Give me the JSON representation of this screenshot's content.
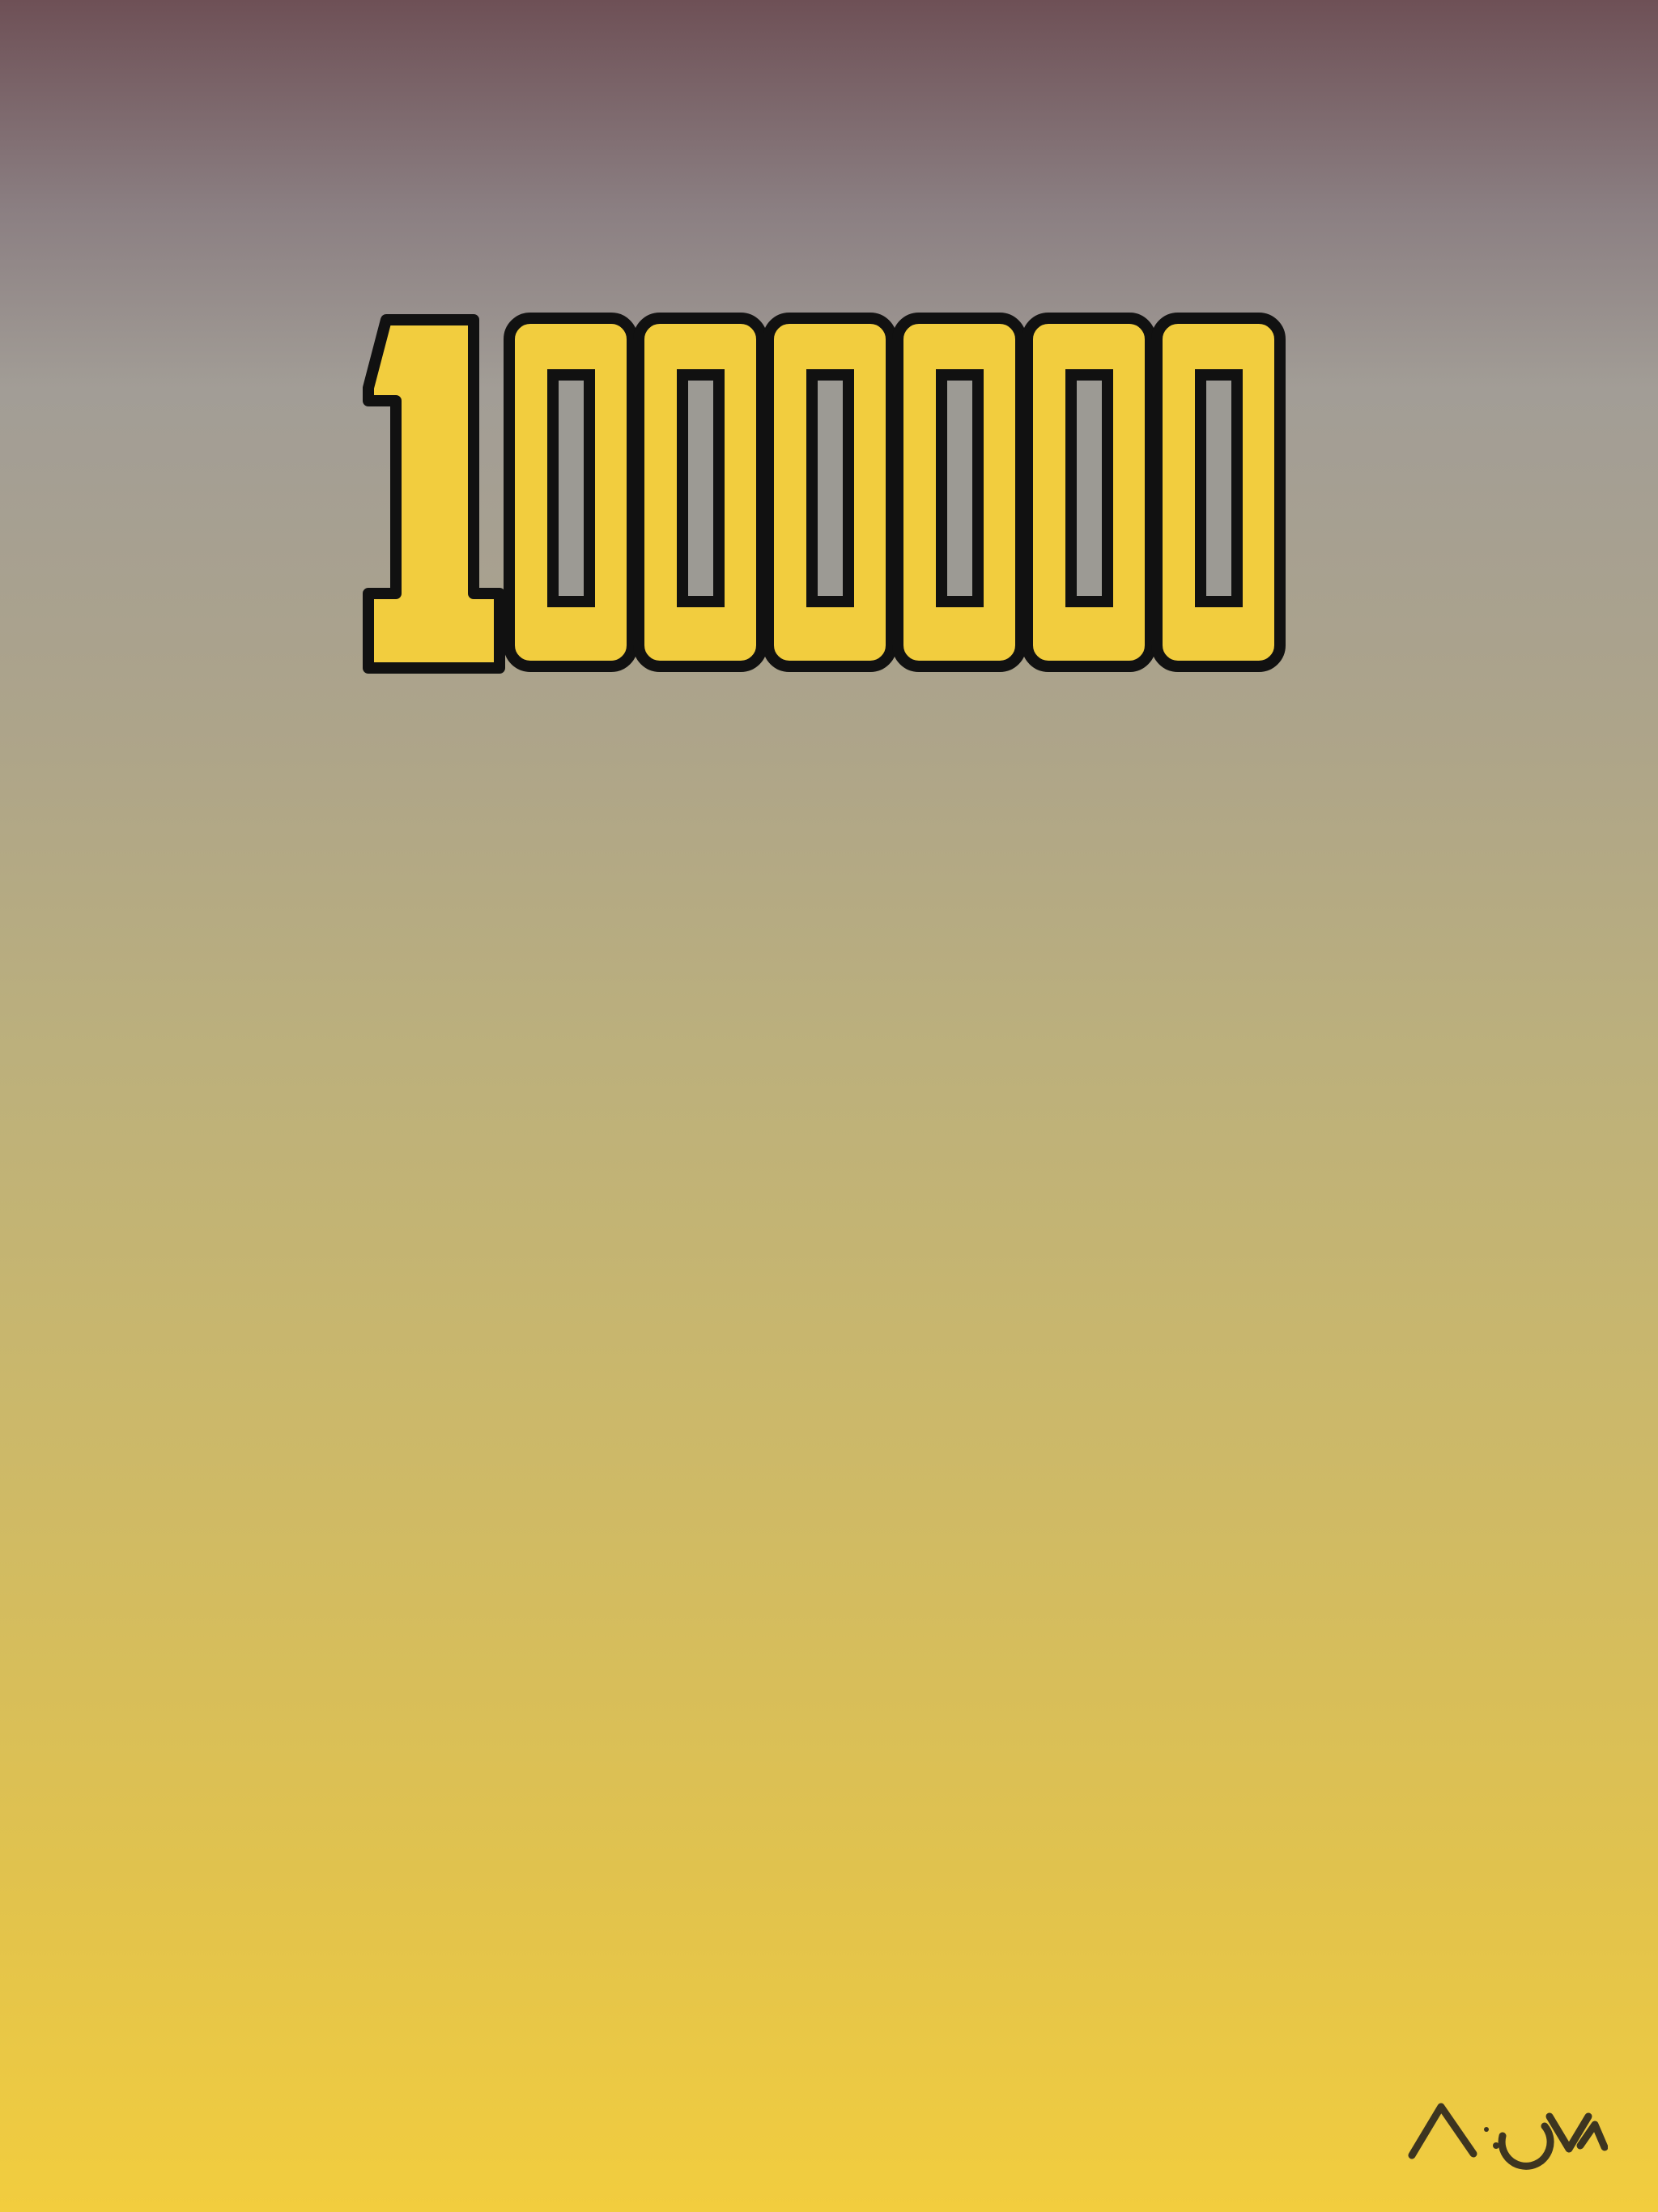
{
  "score": {
    "value": "1000000",
    "digits": [
      "1",
      "0",
      "0",
      "0",
      "0",
      "0",
      "0"
    ]
  },
  "logo": {
    "text": "NOVA",
    "icon": "nova-logo-icon",
    "color": "#3d3520"
  },
  "colors": {
    "background_top": "#6e5056",
    "background_bottom": "#f2cd3e",
    "digit_fill": "#f2cd3e",
    "digit_outline": "#111111",
    "digit_hole": "#9c9a94"
  }
}
